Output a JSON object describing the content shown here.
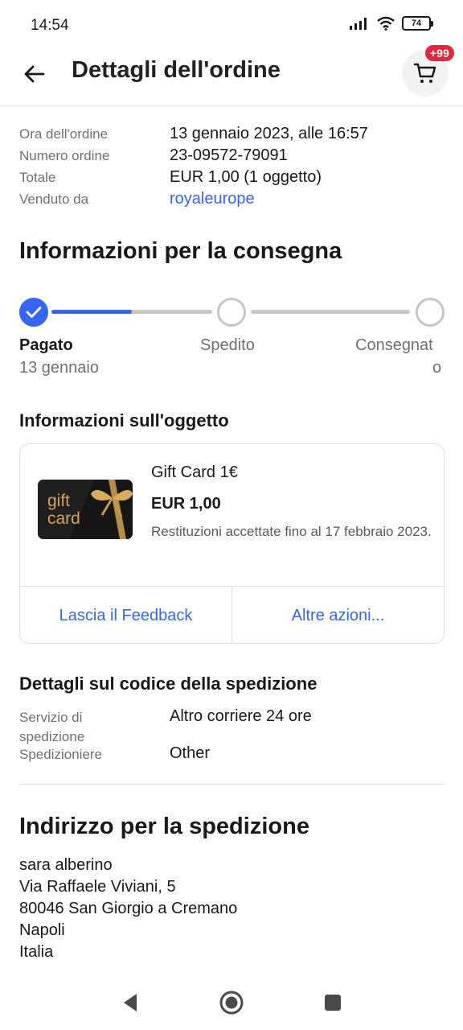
{
  "status_bar": {
    "time": "14:54",
    "battery": "74"
  },
  "header": {
    "title": "Dettagli dell'ordine",
    "cart_badge": "+99"
  },
  "order": {
    "rows": [
      {
        "key": "Ora dell'ordine",
        "value": "13 gennaio 2023, alle 16:57"
      },
      {
        "key": "Numero ordine",
        "value": "23-09572-79091"
      },
      {
        "key": "Totale",
        "value": "EUR 1,00 (1 oggetto)"
      },
      {
        "key": "Venduto da",
        "value": "royaleurope"
      }
    ]
  },
  "delivery": {
    "title": "Informazioni per la consegna",
    "progress_fraction": 0.5,
    "steps": [
      {
        "label": "Pagato",
        "date": "13 gennaio",
        "state": "done"
      },
      {
        "label": "Spedito",
        "state": "pending"
      },
      {
        "label": "Consegnat",
        "label_wrap": "o",
        "state": "pending"
      }
    ]
  },
  "item": {
    "section_title": "Informazioni sull'oggetto",
    "thumbnail_text_line1": "gift",
    "thumbnail_text_line2": "card",
    "title": "Gift Card 1€",
    "price": "EUR 1,00",
    "returns": " Restituzioni accettate fino al 17 febbraio 2023.",
    "actions": [
      "Lascia il Feedback",
      "Altre azioni..."
    ]
  },
  "shipping_code": {
    "title": "Dettagli sul codice della spedizione",
    "rows": [
      {
        "key": "Servizio di spedizione",
        "value": "Altro corriere 24 ore"
      },
      {
        "key": "Spedizioniere",
        "value": "Other"
      }
    ]
  },
  "address": {
    "title": "Indirizzo per la spedizione",
    "lines": [
      "sara alberino",
      "Via Raffaele Viviani, 5",
      "80046 San Giorgio a Cremano",
      "Napoli",
      "Italia"
    ]
  },
  "colors": {
    "accent": "#3665f3",
    "badge": "#e0293b",
    "muted_text": "#707070"
  },
  "icons": {
    "back": "arrow-left-icon",
    "cart": "cart-icon",
    "check": "check-icon",
    "nav_back": "triangle-back-icon",
    "nav_home": "circle-home-icon",
    "nav_recents": "square-recents-icon"
  }
}
